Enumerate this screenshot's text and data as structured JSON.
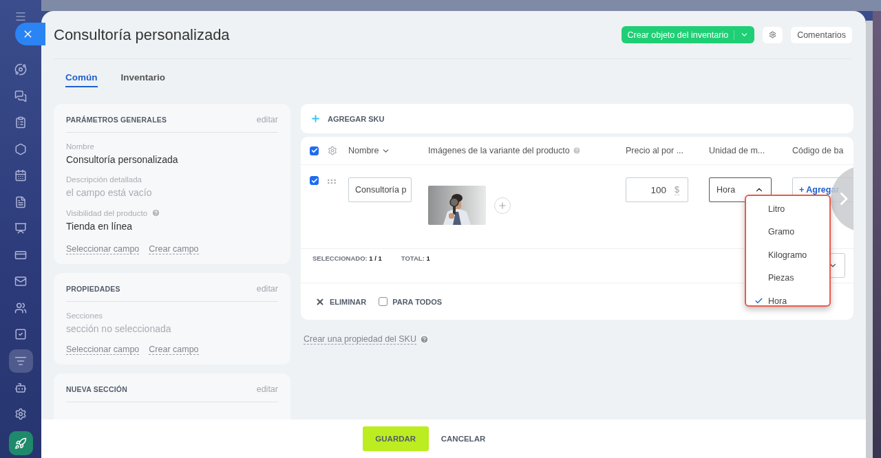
{
  "sidebar": {
    "items": [
      {
        "selected": false
      },
      {
        "selected": false
      },
      {
        "selected": false
      },
      {
        "selected": false
      },
      {
        "selected": false
      },
      {
        "selected": false
      },
      {
        "selected": false
      },
      {
        "selected": false
      },
      {
        "selected": false
      },
      {
        "selected": false
      },
      {
        "selected": false
      },
      {
        "selected": true
      },
      {
        "selected": false
      },
      {
        "selected": false
      }
    ]
  },
  "header": {
    "title": "Consultoría personalizada",
    "primary_button": "Crear objeto del inventario",
    "comments_button": "Comentarios"
  },
  "tabs": [
    {
      "label": "Común",
      "selected": true
    },
    {
      "label": "Inventario",
      "selected": false
    }
  ],
  "cards": [
    {
      "title": "PARÁMETROS GENERALES",
      "action": "editar",
      "fields": [
        {
          "label": "Nombre",
          "value": "Consultoría personalizada",
          "empty": false,
          "help": false
        },
        {
          "label": "Descripción detallada",
          "value": "el campo está vacío",
          "empty": true,
          "help": false
        },
        {
          "label": "Visibilidad del producto",
          "value": "Tienda en línea",
          "empty": false,
          "help": true
        }
      ],
      "links": [
        "Seleccionar campo",
        "Crear campo"
      ]
    },
    {
      "title": "PROPIEDADES",
      "action": "editar",
      "fields": [
        {
          "label": "Secciones",
          "value": "sección no seleccionada",
          "empty": true,
          "help": false
        }
      ],
      "links": [
        "Seleccionar campo",
        "Crear campo"
      ]
    },
    {
      "title": "NUEVA SECCIÓN",
      "action": "editar"
    }
  ],
  "sku": {
    "add_label": "AGREGAR SKU",
    "all_checked": true,
    "columns": [
      {
        "label": "Nombre",
        "sort": true,
        "help": false
      },
      {
        "label": "Imágenes de la variante del producto",
        "sort": false,
        "help": true
      },
      {
        "label": "Precio al por ...",
        "sort": false,
        "help": false
      },
      {
        "label": "Unidad de m...",
        "sort": false,
        "help": false
      },
      {
        "label": "Código de ba",
        "sort": false,
        "help": false
      }
    ],
    "rows": [
      {
        "checked": true,
        "name": "Consultoría p",
        "price": "100",
        "currency": "$",
        "unit": "Hora",
        "add_label": "+ Agregar"
      }
    ],
    "selected_label": "SELECCIONADO:",
    "selected_value": "1 / 1",
    "total_label": "TOTAL:",
    "total_value": "1",
    "delete_label": "ELIMINAR",
    "for_all": {
      "label": "PARA TODOS",
      "checked": false
    }
  },
  "unit_dropdown": {
    "options": [
      {
        "label": "Litro",
        "selected": false
      },
      {
        "label": "Gramo",
        "selected": false
      },
      {
        "label": "Kilogramo",
        "selected": false
      },
      {
        "label": "Piezas",
        "selected": false
      },
      {
        "label": "Hora",
        "selected": true
      }
    ]
  },
  "create_property_link": "Crear una propiedad del SKU",
  "footer": {
    "save": "GUARDAR",
    "cancel": "CANCELAR"
  }
}
